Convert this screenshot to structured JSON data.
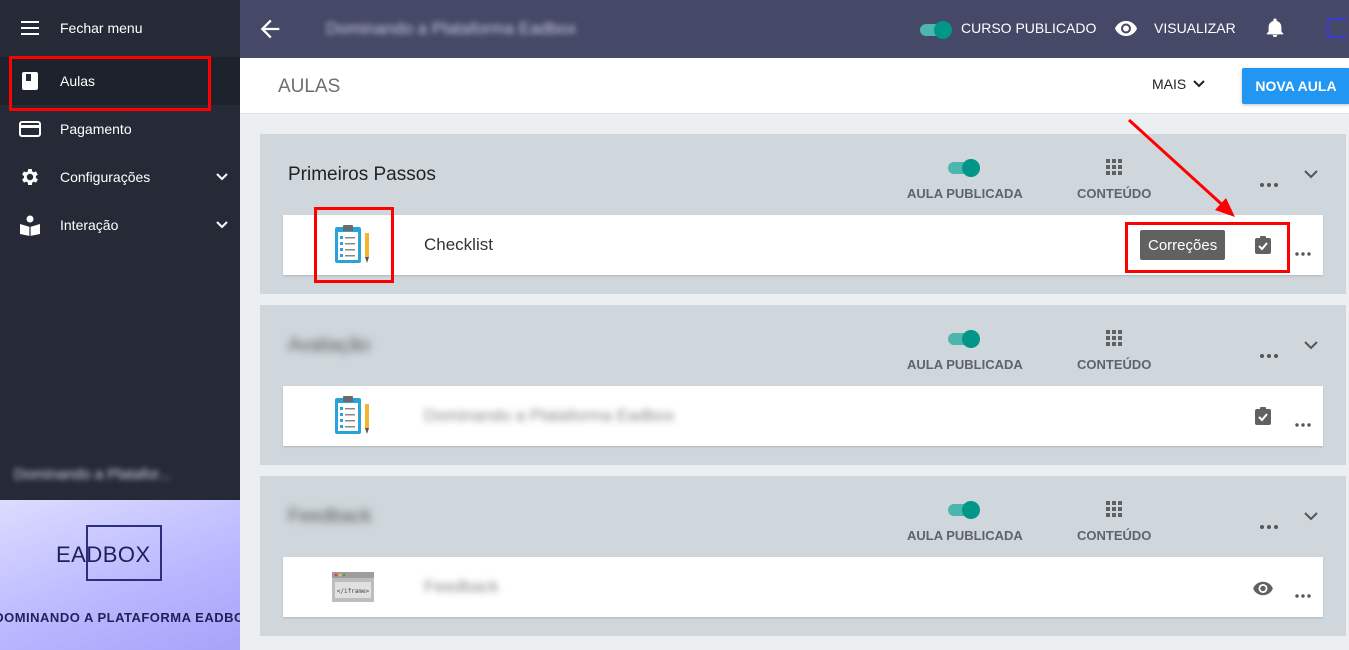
{
  "sidebar": {
    "items": [
      {
        "label": "Fechar menu",
        "icon": "menu-icon"
      },
      {
        "label": "Aulas",
        "icon": "book-icon"
      },
      {
        "label": "Pagamento",
        "icon": "credit-card-icon"
      },
      {
        "label": "Configurações",
        "icon": "gear-icon"
      },
      {
        "label": "Interação",
        "icon": "reading-person-icon"
      }
    ],
    "course_name": "Dominando a Platafor...",
    "banner": {
      "logo": "EADBOX",
      "subtitle": "DOMINANDO A PLATAFORMA EADBOX"
    }
  },
  "topbar": {
    "title": "Dominando a Plataforma Eadbox",
    "published_label": "CURSO PUBLICADO",
    "view_label": "VISUALIZAR"
  },
  "header": {
    "title": "AULAS",
    "more_label": "MAIS",
    "new_lesson_label": "NOVA AULA"
  },
  "sections": [
    {
      "title": "Primeiros Passos",
      "published_label": "AULA PUBLICADA",
      "content_label": "CONTEÚDO",
      "lesson": {
        "title": "Checklist",
        "corrections_label": "Correções",
        "thumb": "clipboard-checklist"
      }
    },
    {
      "title": "Avaliação",
      "published_label": "AULA PUBLICADA",
      "content_label": "CONTEÚDO",
      "lesson": {
        "title": "Dominando a Plataforma Eadbox",
        "thumb": "clipboard-checklist"
      }
    },
    {
      "title": "Feedback",
      "published_label": "AULA PUBLICADA",
      "content_label": "CONTEÚDO",
      "lesson": {
        "title": "Feedback",
        "thumb": "iframe-window",
        "thumb_text": "</iframe>"
      }
    }
  ],
  "colors": {
    "sidebar_bg": "#262a36",
    "topbar_bg": "#454866",
    "accent_blue": "#2196f3",
    "toggle_teal": "#009688",
    "section_bg": "#cfd7dc",
    "annotation_red": "#ff0000"
  }
}
